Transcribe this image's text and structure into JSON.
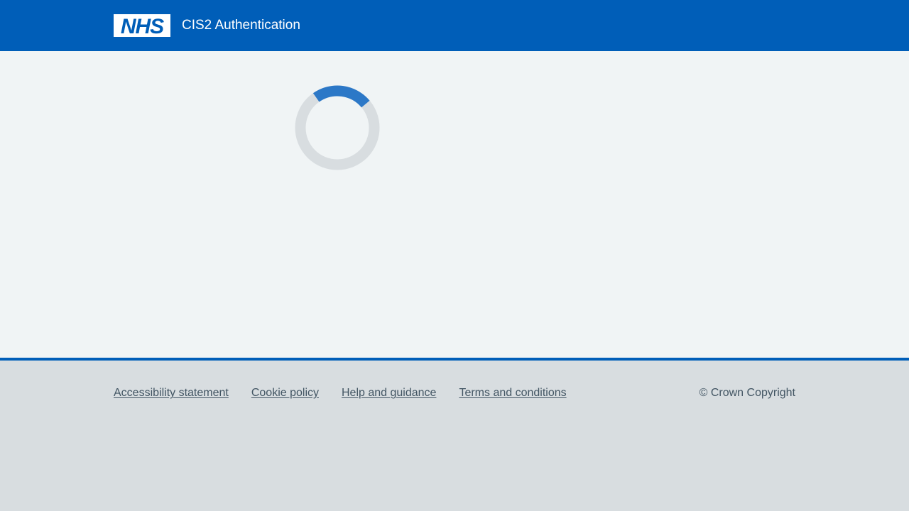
{
  "header": {
    "logo_text": "NHS",
    "service_name": "CIS2 Authentication"
  },
  "main": {
    "loading_indicator": "loading-spinner"
  },
  "footer": {
    "links": [
      {
        "label": "Accessibility statement"
      },
      {
        "label": "Cookie policy"
      },
      {
        "label": "Help and guidance"
      },
      {
        "label": "Terms and conditions"
      }
    ],
    "copyright": "© Crown Copyright"
  },
  "colors": {
    "header_bg": "#005eb8",
    "main_bg": "#f0f4f5",
    "footer_bg": "#d8dde0",
    "footer_text": "#425563",
    "spinner_track": "#d8dde0",
    "spinner_arc": "#2c78c7"
  }
}
